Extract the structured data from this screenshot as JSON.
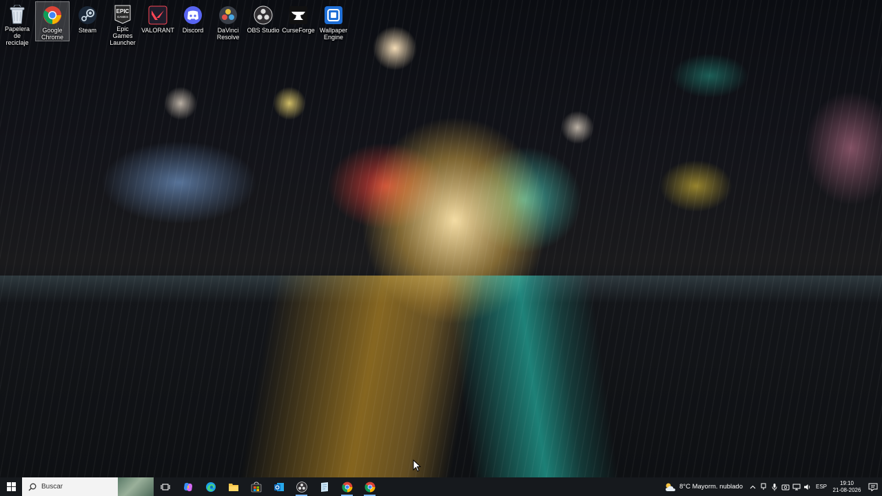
{
  "desktop": {
    "icons": [
      {
        "label": "Papelera de\nreciclaje",
        "icon": "recycle-bin-icon"
      },
      {
        "label": "Google\nChrome",
        "icon": "chrome-icon"
      },
      {
        "label": "Steam",
        "icon": "steam-icon"
      },
      {
        "label": "Epic Games\nLauncher",
        "icon": "epic-games-icon",
        "icon_text": "EPIC"
      },
      {
        "label": "VALORANT",
        "icon": "valorant-icon"
      },
      {
        "label": "Discord",
        "icon": "discord-icon"
      },
      {
        "label": "DaVinci\nResolve",
        "icon": "davinci-resolve-icon"
      },
      {
        "label": "OBS Studio",
        "icon": "obs-icon"
      },
      {
        "label": "CurseForge",
        "icon": "curseforge-icon"
      },
      {
        "label": "Wallpaper\nEngine",
        "icon": "wallpaper-engine-icon"
      }
    ],
    "selected_icon": "Google\nChrome"
  },
  "taskbar": {
    "search_placeholder": "Buscar",
    "pinned": [
      "task-view-icon",
      "copilot-icon",
      "edge-icon",
      "file-explorer-icon",
      "store-icon",
      "outlook-icon",
      "obs-icon",
      "notes-icon",
      "chrome-icon",
      "chrome-icon"
    ],
    "weather": {
      "text": "8°C  Mayorm. nublado",
      "icon": "cloudy-sun-icon"
    },
    "tray_icons": [
      "chevron-up-icon",
      "usb-icon",
      "microphone-icon",
      "camera-icon",
      "network-icon",
      "volume-icon"
    ],
    "language": "ESP",
    "time": "19:10",
    "date": "21-08-2026"
  },
  "colors": {
    "taskbar_bg": "#181a1e",
    "search_bg": "#f3f3f3",
    "accent": "#7fb8ff"
  }
}
